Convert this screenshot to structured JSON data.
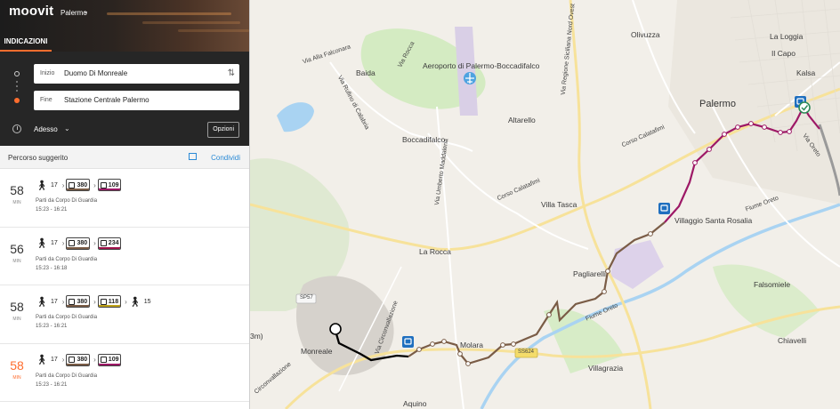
{
  "app": {
    "logo": "moovit",
    "city": "Palermo",
    "tab": "INDICAZIONI"
  },
  "search": {
    "start_label": "Inizio",
    "start_value": "Duomo Di Monreale",
    "end_label": "Fine",
    "end_value": "Stazione Centrale Palermo",
    "when": "Adesso",
    "options": "Opzioni"
  },
  "results": {
    "title": "Percorso suggerito",
    "share": "Condividi"
  },
  "routes": [
    {
      "minutes": "58",
      "unit": "MIN",
      "walk": "17",
      "buses": [
        "380",
        "109"
      ],
      "from": "Parti da Corpo Di Guardia",
      "time": "15:23  -  16:21"
    },
    {
      "minutes": "56",
      "unit": "MIN",
      "walk": "17",
      "buses": [
        "380",
        "234"
      ],
      "from": "Parti da Corpo Di Guardia",
      "time": "15:23  -  16:18"
    },
    {
      "minutes": "58",
      "unit": "MIN",
      "walk": "17",
      "buses": [
        "380",
        "118"
      ],
      "walk_end": "15",
      "from": "Parti da Corpo Di Guardia",
      "time": "15:23  -  16:21"
    },
    {
      "minutes": "58",
      "unit": "MIN",
      "walk": "17",
      "buses": [
        "380",
        "109"
      ],
      "from": "Parti da Corpo Di Guardia",
      "time": "15:23  -  16:21"
    }
  ],
  "map": {
    "places": [
      "Olivuzza",
      "La Loggia",
      "Il Capo",
      "Kalsa",
      "Palermo",
      "Baida",
      "Aeroporto di Palermo-Boccadifalco",
      "Altarello",
      "Boccadifalco",
      "Villa Tasca",
      "Villaggio Santa Rosalia",
      "La Rocca",
      "Pagliarelli",
      "Falsomiele",
      "Molara",
      "Monreale",
      "Villagrazia",
      "Chiavelli",
      "Aquino",
      "3m)"
    ],
    "roads": [
      "Via Alla Falconara",
      "Via Rocca",
      "Via Rufino di Calabria",
      "Corso Calatafimi",
      "Via Umberto Maddalena",
      "Via Regione Siciliana Nord Ovest",
      "Via Circonvallazione",
      "Via Oreto",
      "Fiume Oreto",
      "SP57",
      "SS624",
      "Circonvallazione"
    ]
  },
  "colors": {
    "accent": "#ff6d2e",
    "bus_line_a": "#7a5c46",
    "bus_line_b": "#9d1866",
    "walk": "#000000",
    "water": "#a9d3f2",
    "park": "#c8e6b0"
  }
}
